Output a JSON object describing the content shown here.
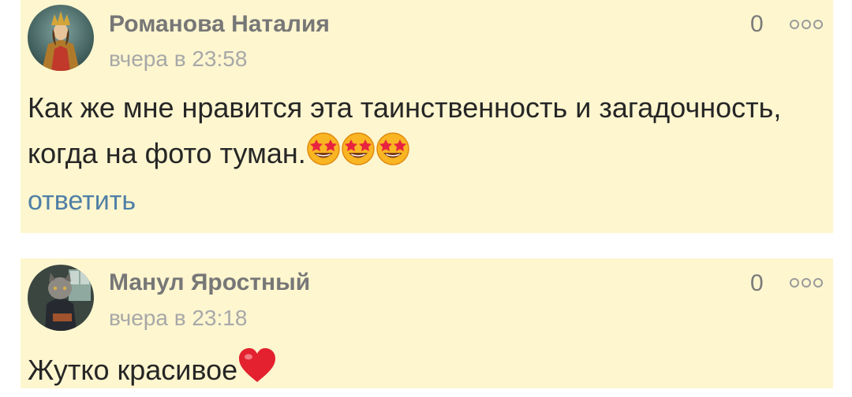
{
  "comments": [
    {
      "author": "Романова Наталия",
      "time": "вчера в 23:58",
      "likes": "0",
      "text": "Как же мне нравится эта таинственность и загадочность, когда на фото туман.",
      "emoji": [
        "star-struck",
        "star-struck",
        "star-struck"
      ],
      "reply_label": "ответить"
    },
    {
      "author": "Манул Яростный",
      "time": "вчера в 23:18",
      "likes": "0",
      "text": "Жутко красивое",
      "emoji": [
        "red-heart"
      ]
    }
  ],
  "colors": {
    "card_background": "#fdf6cf",
    "author": "#777777",
    "time": "#a8a8a8",
    "reply_link": "#4f7fa6"
  }
}
